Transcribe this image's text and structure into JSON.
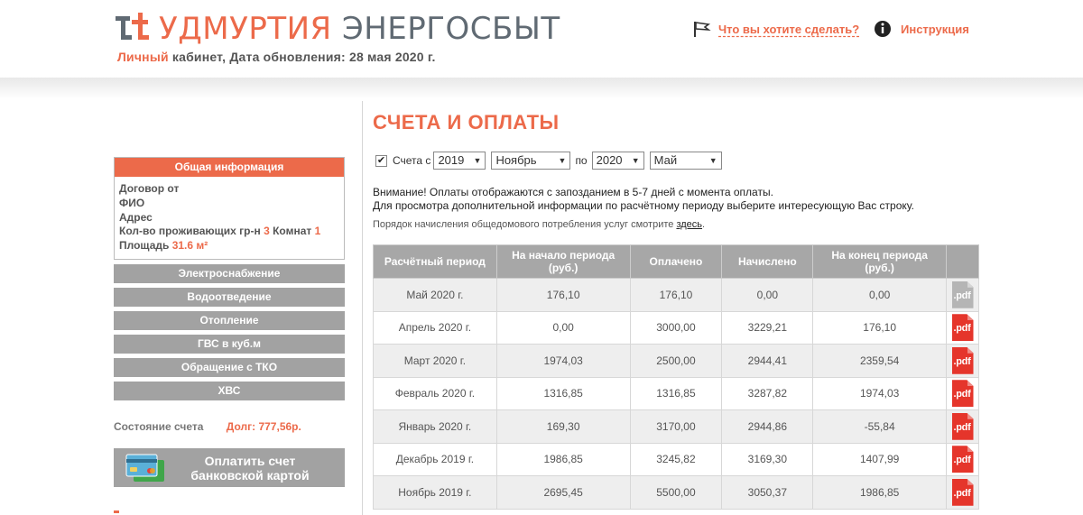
{
  "header": {
    "brand_part1": "УДМУРТИЯ",
    "brand_part2": "ЭНЕРГОСБЫТ",
    "sub_highlight": "Личный",
    "sub_text": "кабинет, Дата обновления: 28 мая 2020 г.",
    "what_to_do": "Что вы хотите сделать?",
    "instruction": "Инструкция",
    "icons": [
      "flag-icon",
      "info-icon"
    ]
  },
  "colors": {
    "accent": "#ec6a4a",
    "gray_button": "#a2a2a2",
    "pdf_red": "#e5352b"
  },
  "sidebar": {
    "info_title": "Общая информация",
    "contract_label": "Договор от",
    "fio_label": "ФИО",
    "address_label": "Адрес",
    "residents_label": "Кол-во проживающих гр-н",
    "residents_value": "3",
    "rooms_label": "Комнат",
    "rooms_value": "1",
    "area_label": "Площадь",
    "area_value": "31.6 м²",
    "buttons": [
      "Электроснабжение",
      "Водоотведение",
      "Отопление",
      "ГВС в куб.м",
      "Обращение с ТКО",
      "ХВС"
    ],
    "account_state_label": "Состояние счета",
    "debt": "Долг: 777,56р.",
    "pay_line1": "Оплатить счет",
    "pay_line2": "банковской картой"
  },
  "main": {
    "title": "СЧЕТА И ОПЛАТЫ",
    "filter": {
      "checked": true,
      "label_from": "Счета с",
      "year_from": "2019",
      "month_from": "Ноябрь",
      "label_to": "по",
      "year_to": "2020",
      "month_to": "Май"
    },
    "notice_line1": "Внимание! Оплаты отображаются с запозданием в 5-7 дней с момента оплаты.",
    "notice_line2": "Для просмотра дополнительной информации по расчётному периоду выберите интересующую Вас строку.",
    "order_note": "Порядок начисления общедомового потребления услуг смотрите",
    "order_link": "здесь",
    "order_dot": "."
  },
  "table": {
    "headers": [
      "Расчётный период",
      "На начало периода (руб.)",
      "Оплачено",
      "Начислено",
      "На конец периода (руб.)",
      ""
    ],
    "pdf_label": ".pdf",
    "rows": [
      [
        "Май 2020 г.",
        "176,10",
        "176,10",
        "0,00",
        "0,00"
      ],
      [
        "Апрель 2020 г.",
        "0,00",
        "3000,00",
        "3229,21",
        "176,10"
      ],
      [
        "Март 2020 г.",
        "1974,03",
        "2500,00",
        "2944,41",
        "2359,54"
      ],
      [
        "Февраль 2020 г.",
        "1316,85",
        "1316,85",
        "3287,82",
        "1974,03"
      ],
      [
        "Январь 2020 г.",
        "169,30",
        "3170,00",
        "2944,86",
        "-55,84"
      ],
      [
        "Декабрь 2019 г.",
        "1986,85",
        "3245,82",
        "3169,30",
        "1407,99"
      ],
      [
        "Ноябрь 2019 г.",
        "2695,45",
        "5500,00",
        "3050,37",
        "1986,85"
      ]
    ]
  }
}
